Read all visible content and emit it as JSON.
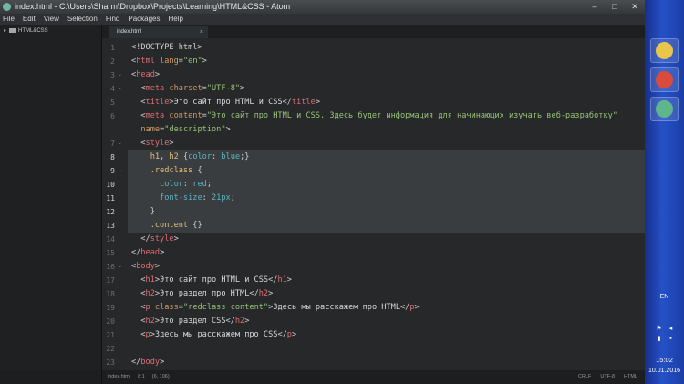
{
  "window": {
    "title": "index.html - C:\\Users\\Sharm\\Dropbox\\Projects\\Learning\\HTML&CSS - Atom",
    "controls": {
      "minimize": "–",
      "maximize": "□",
      "close": "✕"
    }
  },
  "menu": [
    "File",
    "Edit",
    "View",
    "Selection",
    "Find",
    "Packages",
    "Help"
  ],
  "tree": {
    "root": "HTML&CSS"
  },
  "tabs": [
    {
      "label": "index.html",
      "close": "×"
    }
  ],
  "editor": {
    "active_lines": [
      8,
      9,
      10,
      11,
      12,
      13
    ],
    "fold_lines": [
      3,
      4,
      7,
      9,
      16
    ],
    "lines": [
      {
        "n": "1",
        "tokens": [
          [
            "p",
            "<!DOCTYPE html>"
          ]
        ]
      },
      {
        "n": "2",
        "tokens": [
          [
            "p",
            "<"
          ],
          [
            "tn",
            "html"
          ],
          [
            "p",
            " "
          ],
          [
            "at",
            "lang"
          ],
          [
            "p",
            "="
          ],
          [
            "st",
            "\"en\""
          ],
          [
            "p",
            ">"
          ]
        ]
      },
      {
        "n": "3",
        "tokens": [
          [
            "p",
            "<"
          ],
          [
            "tn",
            "head"
          ],
          [
            "p",
            ">"
          ]
        ]
      },
      {
        "n": "4",
        "tokens": [
          [
            "p",
            "  <"
          ],
          [
            "tn",
            "meta"
          ],
          [
            "p",
            " "
          ],
          [
            "at",
            "charset"
          ],
          [
            "p",
            "="
          ],
          [
            "st",
            "\"UTF-8\""
          ],
          [
            "p",
            ">"
          ]
        ]
      },
      {
        "n": "5",
        "tokens": [
          [
            "p",
            "  <"
          ],
          [
            "tn",
            "title"
          ],
          [
            "p",
            ">"
          ],
          [
            "ct",
            "Это сайт про HTML и CSS"
          ],
          [
            "p",
            "</"
          ],
          [
            "tn",
            "title"
          ],
          [
            "p",
            ">"
          ]
        ]
      },
      {
        "n": "6",
        "tokens": [
          [
            "p",
            "  <"
          ],
          [
            "tn",
            "meta"
          ],
          [
            "p",
            " "
          ],
          [
            "at",
            "content"
          ],
          [
            "p",
            "="
          ],
          [
            "st",
            "\"Это сайт про HTML и CSS. Здесь будет информация для начинающих изучать веб-разработку\""
          ]
        ]
      },
      {
        "n": "",
        "tokens": [
          [
            "p",
            "  "
          ],
          [
            "at",
            "name"
          ],
          [
            "p",
            "="
          ],
          [
            "st",
            "\"description\""
          ],
          [
            "p",
            ">"
          ]
        ]
      },
      {
        "n": "7",
        "tokens": [
          [
            "p",
            "  <"
          ],
          [
            "tn",
            "style"
          ],
          [
            "p",
            ">"
          ]
        ]
      },
      {
        "n": "8",
        "tokens": [
          [
            "p",
            "    "
          ],
          [
            "sel",
            "h1"
          ],
          [
            "p",
            ", "
          ],
          [
            "sel",
            "h2"
          ],
          [
            "p",
            " {"
          ],
          [
            "vl",
            "color"
          ],
          [
            "p",
            ": "
          ],
          [
            "vl",
            "blue"
          ],
          [
            "p",
            ";}"
          ]
        ]
      },
      {
        "n": "9",
        "tokens": [
          [
            "p",
            "    "
          ],
          [
            "cl",
            ".redclass"
          ],
          [
            "p",
            " {"
          ]
        ]
      },
      {
        "n": "10",
        "tokens": [
          [
            "p",
            "      "
          ],
          [
            "vl",
            "color"
          ],
          [
            "p",
            ": "
          ],
          [
            "vl",
            "red"
          ],
          [
            "p",
            ";"
          ]
        ]
      },
      {
        "n": "11",
        "tokens": [
          [
            "p",
            "      "
          ],
          [
            "vl",
            "font-size"
          ],
          [
            "p",
            ": "
          ],
          [
            "vl",
            "21px"
          ],
          [
            "p",
            ";"
          ]
        ]
      },
      {
        "n": "12",
        "tokens": [
          [
            "p",
            "    }"
          ]
        ]
      },
      {
        "n": "13",
        "tokens": [
          [
            "p",
            "    "
          ],
          [
            "cl",
            ".content"
          ],
          [
            "p",
            " {}"
          ]
        ]
      },
      {
        "n": "14",
        "tokens": [
          [
            "p",
            "  </"
          ],
          [
            "tn",
            "style"
          ],
          [
            "p",
            ">"
          ]
        ]
      },
      {
        "n": "15",
        "tokens": [
          [
            "p",
            "</"
          ],
          [
            "tn",
            "head"
          ],
          [
            "p",
            ">"
          ]
        ]
      },
      {
        "n": "16",
        "tokens": [
          [
            "p",
            "<"
          ],
          [
            "tn",
            "body"
          ],
          [
            "p",
            ">"
          ]
        ]
      },
      {
        "n": "17",
        "tokens": [
          [
            "p",
            "  <"
          ],
          [
            "tn",
            "h1"
          ],
          [
            "p",
            ">"
          ],
          [
            "ct",
            "Это сайт про HTML и CSS"
          ],
          [
            "p",
            "</"
          ],
          [
            "tn",
            "h1"
          ],
          [
            "p",
            ">"
          ]
        ]
      },
      {
        "n": "18",
        "tokens": [
          [
            "p",
            "  <"
          ],
          [
            "tn",
            "h2"
          ],
          [
            "p",
            ">"
          ],
          [
            "ct",
            "Это раздел про HTML"
          ],
          [
            "p",
            "</"
          ],
          [
            "tn",
            "h2"
          ],
          [
            "p",
            ">"
          ]
        ]
      },
      {
        "n": "19",
        "tokens": [
          [
            "p",
            "  <"
          ],
          [
            "tn",
            "p"
          ],
          [
            "p",
            " "
          ],
          [
            "at",
            "class"
          ],
          [
            "p",
            "="
          ],
          [
            "st",
            "\"redclass content\""
          ],
          [
            "p",
            ">"
          ],
          [
            "ct",
            "Здесь мы расскажем про HTML"
          ],
          [
            "p",
            "</"
          ],
          [
            "tn",
            "p"
          ],
          [
            "p",
            ">"
          ]
        ]
      },
      {
        "n": "20",
        "tokens": [
          [
            "p",
            "  <"
          ],
          [
            "tn",
            "h2"
          ],
          [
            "p",
            ">"
          ],
          [
            "ct",
            "Это раздел CSS"
          ],
          [
            "p",
            "</"
          ],
          [
            "tn",
            "h2"
          ],
          [
            "p",
            ">"
          ]
        ]
      },
      {
        "n": "21",
        "tokens": [
          [
            "p",
            "  <"
          ],
          [
            "tn",
            "p"
          ],
          [
            "p",
            ">"
          ],
          [
            "ct",
            "Здесь мы расскажем про CSS"
          ],
          [
            "p",
            "</"
          ],
          [
            "tn",
            "p"
          ],
          [
            "p",
            ">"
          ]
        ]
      },
      {
        "n": "22",
        "tokens": []
      },
      {
        "n": "23",
        "tokens": [
          [
            "p",
            "</"
          ],
          [
            "tn",
            "body"
          ],
          [
            "p",
            ">"
          ]
        ]
      }
    ]
  },
  "status": {
    "file": "index.html",
    "cursor": "8:1",
    "position": "(6, 106)",
    "line_ending": "CRLF",
    "encoding": "UTF-8",
    "grammar": "HTML"
  },
  "taskbar": {
    "apps": [
      {
        "icon": "file-explorer-icon",
        "color": "#e8c64a"
      },
      {
        "icon": "chrome-icon",
        "color": "#d94b3b"
      },
      {
        "icon": "atom-icon",
        "color": "#5fb58c"
      }
    ],
    "language": "EN",
    "time": "15:02",
    "date": "10.01.2016"
  }
}
